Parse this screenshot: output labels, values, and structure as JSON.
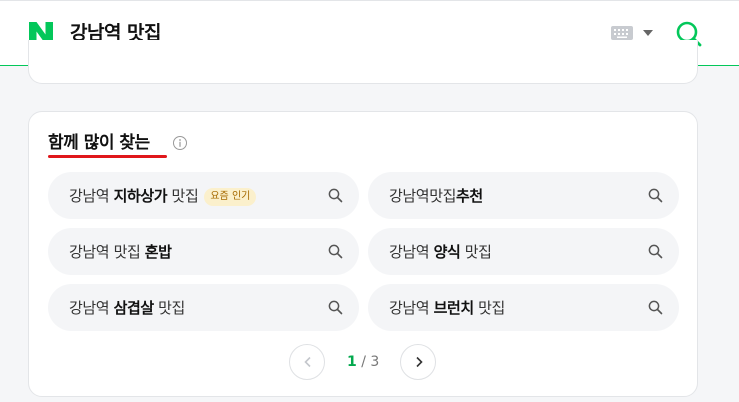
{
  "header": {
    "query": "강남역 맛집",
    "logo_icon": "naver-n-logo",
    "keyboard_icon": "keyboard-icon",
    "search_icon": "search-icon",
    "brand_color": "#03c75a"
  },
  "related_section": {
    "title": "함께 많이 찾는",
    "info_icon": "info-icon",
    "underline_color": "#e0171b",
    "chips": [
      {
        "prefix": "강남역 ",
        "bold": "지하상가",
        "suffix": " 맛집",
        "badge": "요즘 인기"
      },
      {
        "prefix": "강남역맛집",
        "bold": "추천",
        "suffix": "",
        "badge": ""
      },
      {
        "prefix": "강남역 맛집 ",
        "bold": "혼밥",
        "suffix": "",
        "badge": ""
      },
      {
        "prefix": "강남역 ",
        "bold": "양식",
        "suffix": " 맛집",
        "badge": ""
      },
      {
        "prefix": "강남역 ",
        "bold": "삼겹살",
        "suffix": " 맛집",
        "badge": ""
      },
      {
        "prefix": "강남역 ",
        "bold": "브런치",
        "suffix": " 맛집",
        "badge": ""
      }
    ],
    "pager": {
      "current": "1",
      "separator": " / ",
      "total": "3",
      "prev_icon": "chevron-left-icon",
      "next_icon": "chevron-right-icon"
    }
  }
}
